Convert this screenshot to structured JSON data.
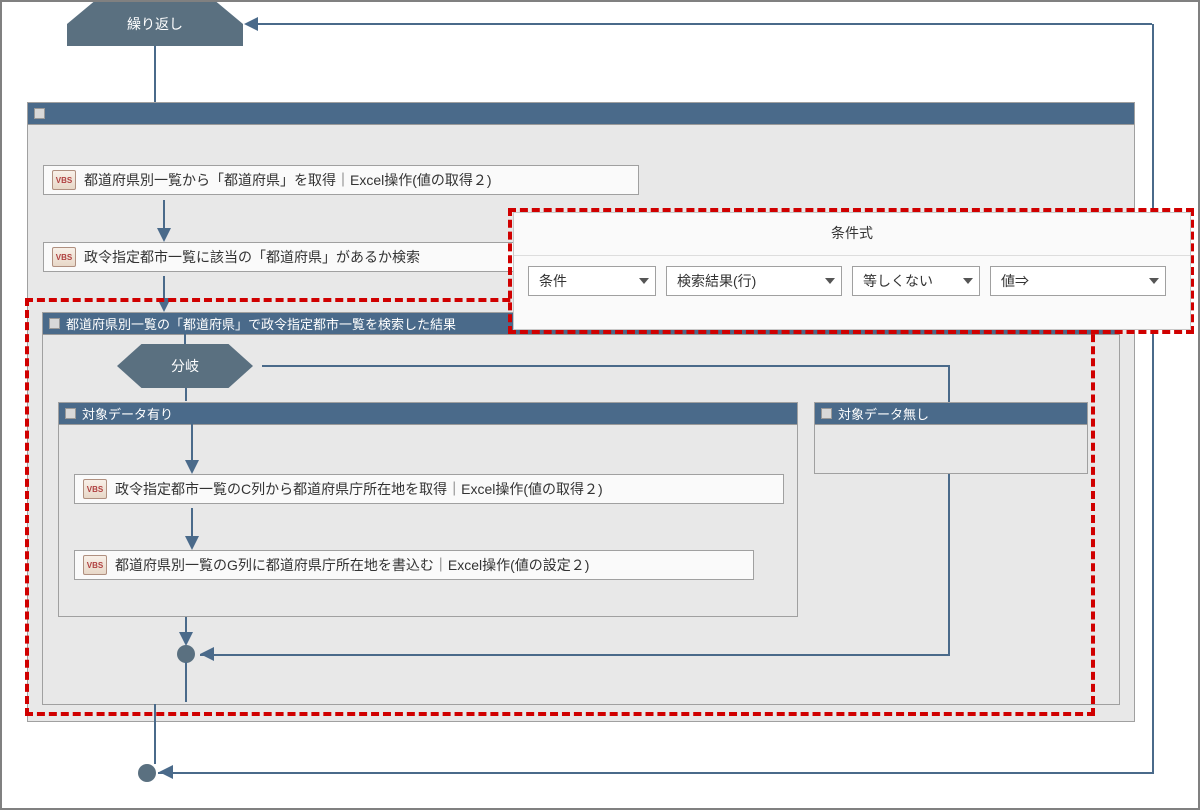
{
  "loop_label": "繰り返し",
  "branch_label": "分岐",
  "container_search_result_title": "都道府県別一覧の「都道府県」で政令指定都市一覧を検索した結果",
  "step1": "都道府県別一覧から「都道府県」を取得｜Excel操作(値の取得２)",
  "step2": "政令指定都市一覧に該当の「都道府県」があるか検索",
  "step3": "政令指定都市一覧のC列から都道府県庁所在地を取得｜Excel操作(値の取得２)",
  "step4": "都道府県別一覧のG列に都道府県庁所在地を書込む｜Excel操作(値の設定２)",
  "branch_yes_title": "対象データ有り",
  "branch_no_title": "対象データ無し",
  "popup": {
    "title": "条件式",
    "field1": "条件",
    "field2": "検索結果(行)",
    "field3": "等しくない",
    "field4": "値⇒"
  }
}
